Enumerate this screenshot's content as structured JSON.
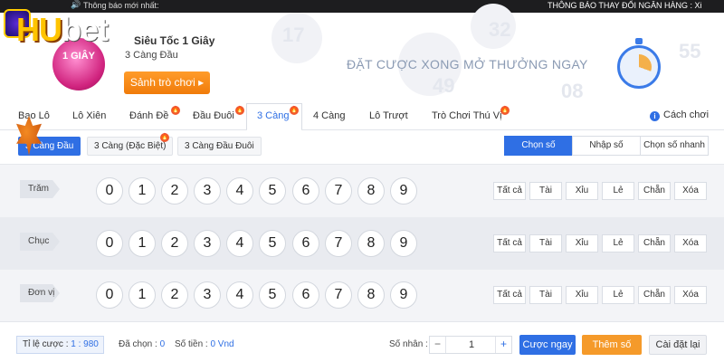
{
  "topbar": {
    "news_label": "Thông báo mới nhất:",
    "news_text": "THÔNG BÁO THAY ĐỔI NGÂN HÀNG :    Xi"
  },
  "brand": {
    "logo_part1": "HU",
    "logo_part2": "bet"
  },
  "header": {
    "game_title": "Siêu Tốc 1 Giây",
    "game_subtitle": "3 Càng Đầu",
    "game_badge": "1 GIÂY",
    "lobby_button": "Sảnh trò chơi ▸",
    "slogan": "ĐẶT CƯỢC XONG MỞ THƯỞNG NGAY",
    "deco_numbers": [
      "17",
      "49",
      "32",
      "55",
      "08"
    ]
  },
  "tabs": [
    {
      "label": "Bao Lô",
      "active": false,
      "hot": false
    },
    {
      "label": "Lô Xiên",
      "active": false,
      "hot": false
    },
    {
      "label": "Đánh Đề",
      "active": false,
      "hot": true
    },
    {
      "label": "Đầu Đuôi",
      "active": false,
      "hot": true
    },
    {
      "label": "3 Càng",
      "active": true,
      "hot": true
    },
    {
      "label": "4 Càng",
      "active": false,
      "hot": false
    },
    {
      "label": "Lô Trượt",
      "active": false,
      "hot": false
    },
    {
      "label": "Trò Chơi Thú Vị",
      "active": false,
      "hot": true
    }
  ],
  "howto_label": "Cách chơi",
  "subtabs": [
    {
      "label": "3 Càng Đầu",
      "active": true,
      "hot": false
    },
    {
      "label": "3 Càng (Đặc Biệt)",
      "active": false,
      "hot": true
    },
    {
      "label": "3 Càng Đầu Đuôi",
      "active": false,
      "hot": false
    }
  ],
  "modes": [
    {
      "label": "Chọn số",
      "active": true
    },
    {
      "label": "Nhập số",
      "active": false
    },
    {
      "label": "Chọn số nhanh",
      "active": false
    }
  ],
  "rows": [
    {
      "label": "Trăm"
    },
    {
      "label": "Chục"
    },
    {
      "label": "Đơn vị"
    }
  ],
  "digits": [
    "0",
    "1",
    "2",
    "3",
    "4",
    "5",
    "6",
    "7",
    "8",
    "9"
  ],
  "quick_buttons": [
    "Tất cả",
    "Tài",
    "Xỉu",
    "Lẻ",
    "Chẵn",
    "Xóa"
  ],
  "footer": {
    "rate_label": "Tỉ lệ cược : ",
    "rate_value": "1 : 980",
    "selected_label": "Đã chọn : ",
    "selected_value": "0",
    "amount_label": "Số tiền : ",
    "amount_value": "0 Vnd",
    "multiplier_label": "Số nhân :",
    "multiplier_value": "1",
    "minus": "−",
    "plus": "+",
    "bet_now": "Cược ngay",
    "add_number": "Thêm số",
    "reset": "Cài đặt lại"
  },
  "colors": {
    "accent": "#2f6fe4",
    "orange": "#f59a2a",
    "hot": "#f2592f"
  }
}
